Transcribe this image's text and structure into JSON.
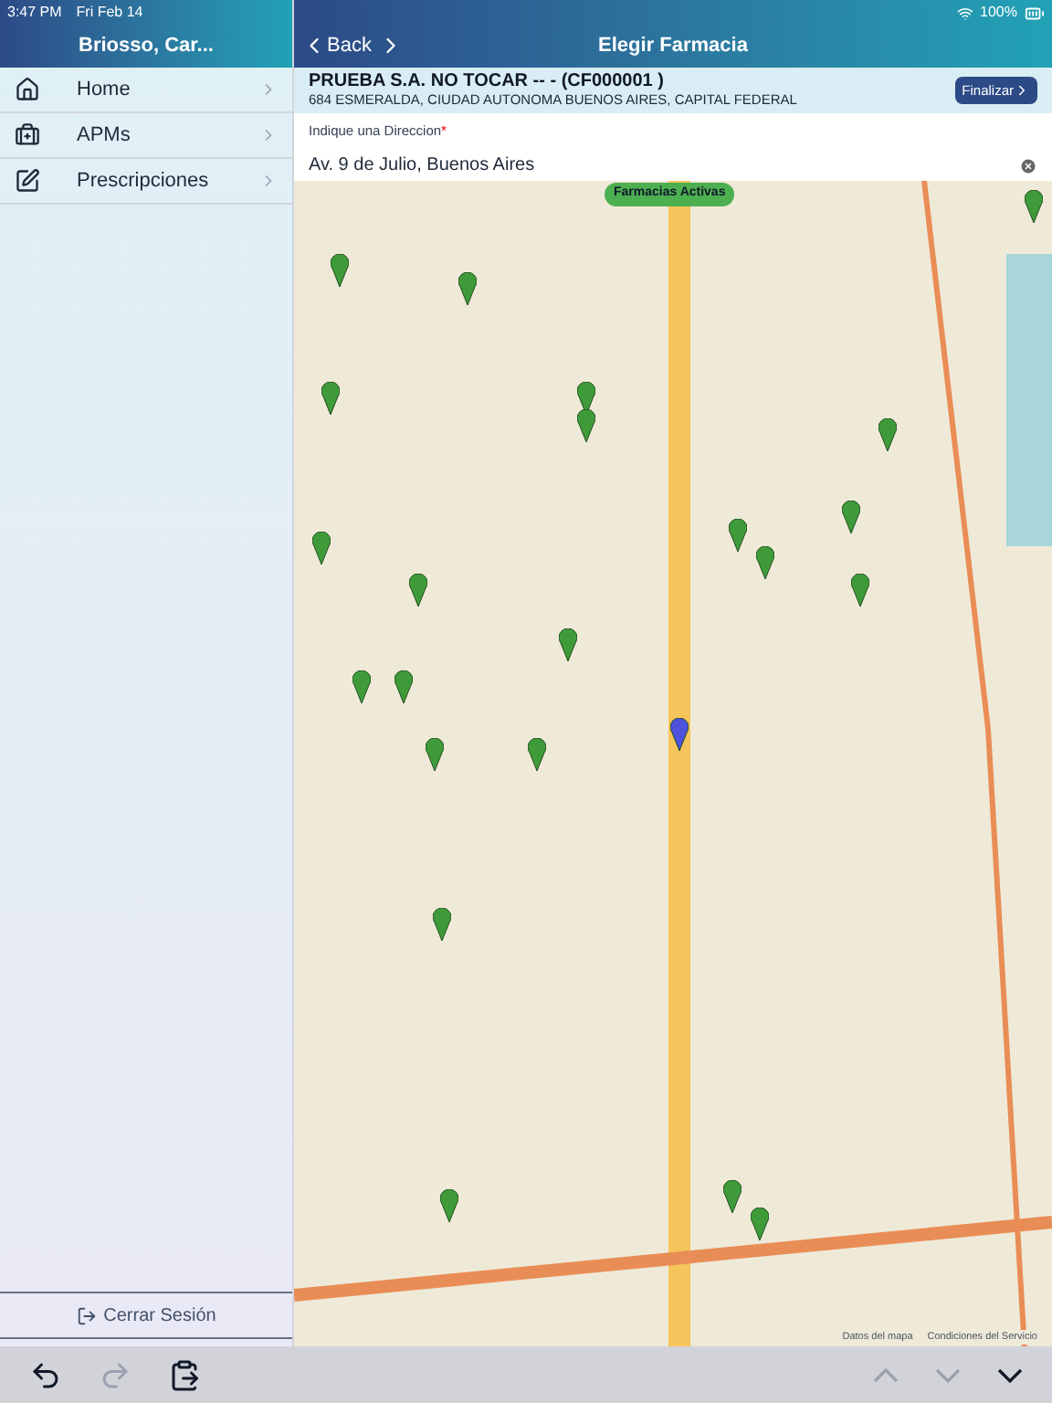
{
  "status_bar": {
    "time": "3:47 PM",
    "date": "Fri Feb 14",
    "battery": "100%"
  },
  "sidebar": {
    "title": "Briosso, Car...",
    "items": [
      {
        "label": "Home",
        "kind": "home"
      },
      {
        "label": "APMs",
        "kind": "kit"
      },
      {
        "label": "Prescripciones",
        "kind": "edit"
      }
    ],
    "logout": "Cerrar Sesión"
  },
  "nav": {
    "back": "Back",
    "title": "Elegir Farmacia"
  },
  "client": {
    "name": "PRUEBA S.A. NO TOCAR -- - (CF000001 )",
    "address": "684 ESMERALDA, CIUDAD AUTONOMA BUENOS AIRES, CAPITAL FEDERAL",
    "action": "Finalizar"
  },
  "address_field": {
    "label": "Indique una Direccion",
    "required": "*",
    "value": "Av. 9 de Julio, Buenos Aires"
  },
  "map": {
    "badge": "Farmacias Activas",
    "attribution": [
      "Datos del mapa",
      "Condiciones del Servicio"
    ]
  },
  "toolbar": [
    {
      "kind": "undo",
      "disabled": false
    },
    {
      "kind": "redo",
      "disabled": true
    },
    {
      "kind": "paste",
      "disabled": false
    },
    {
      "kind": "up",
      "disabled": true
    },
    {
      "kind": "down",
      "disabled": true
    },
    {
      "kind": "dismiss",
      "disabled": false
    }
  ]
}
